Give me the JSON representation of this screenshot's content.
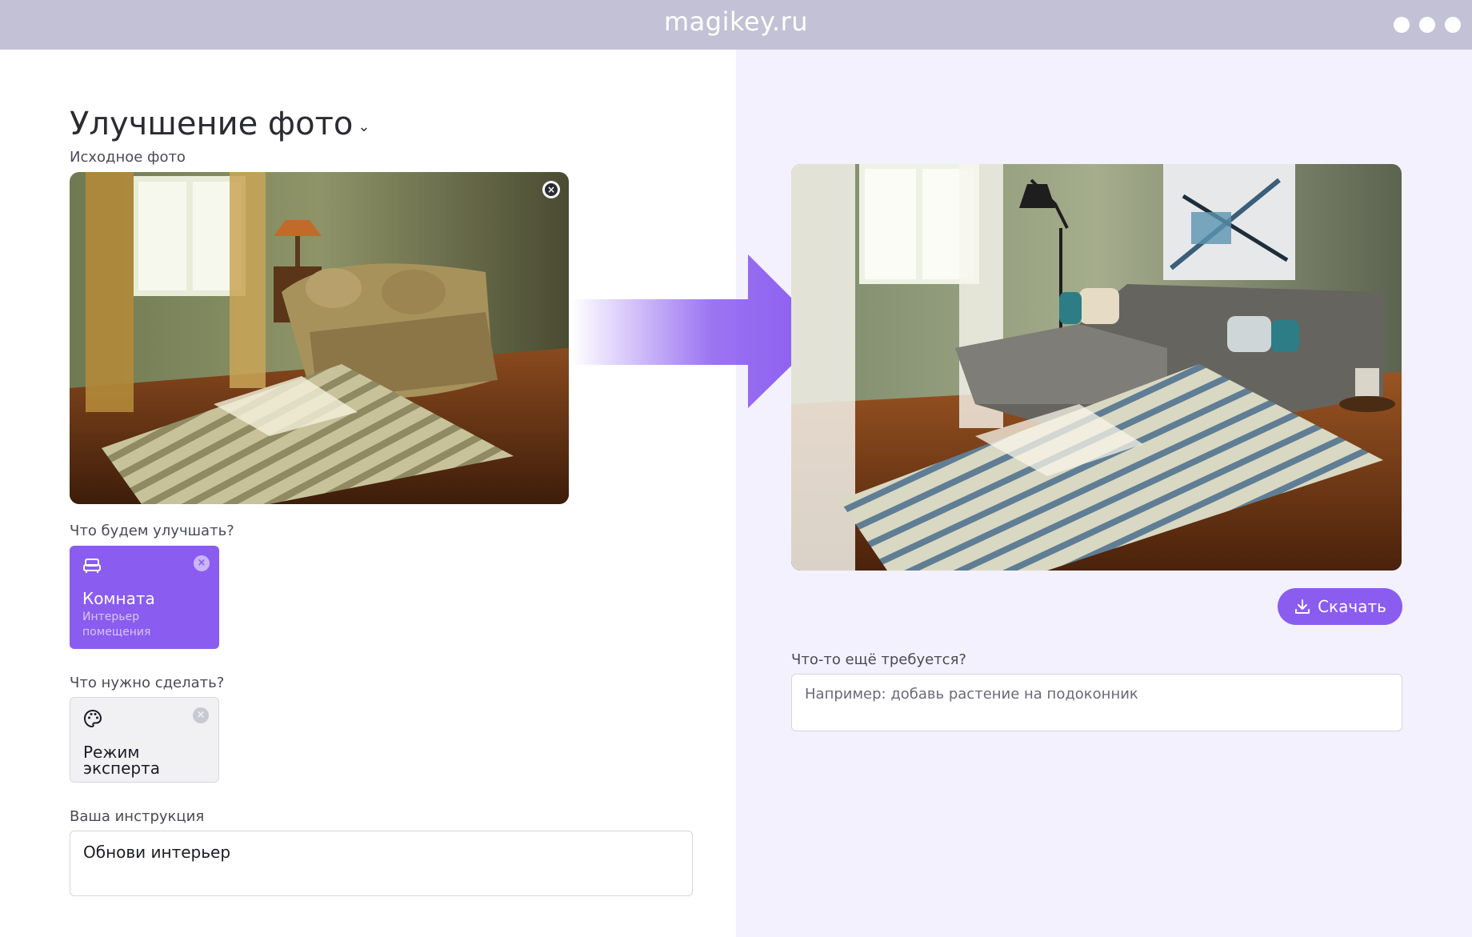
{
  "window": {
    "site": "magikey.ru"
  },
  "page": {
    "title": "Улучшение фото",
    "source_label": "Исходное фото"
  },
  "target": {
    "label": "Что будем улучшать?",
    "title": "Комната",
    "subtitle": "Интерьер помещения"
  },
  "action": {
    "label": "Что нужно сделать?",
    "title": "Режим эксперта"
  },
  "instruction": {
    "label": "Ваша инструкция",
    "value": "Обнови интерьер"
  },
  "result": {
    "download_label": "Скачать",
    "more_label": "Что-то ещё требуется?",
    "more_placeholder": "Например: добавь растение на подоконник"
  },
  "icons": {
    "close": "close-icon",
    "sofa": "sofa-icon",
    "palette": "palette-icon",
    "download": "download-icon",
    "arrow": "arrow-right-icon",
    "chevron": "chevron-down-icon"
  },
  "colors": {
    "accent": "#8a5cf0",
    "titlebar": "#c3c1d6",
    "right_bg": "#f3f1fd"
  }
}
